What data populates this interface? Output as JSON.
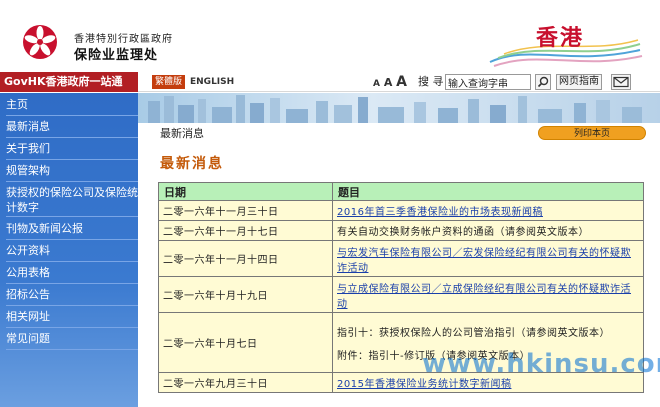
{
  "header": {
    "dept_line1": "香港特別行政區政府",
    "dept_line2": "保险业监理处",
    "brand": "香港"
  },
  "govbar": {
    "govhk": "GovHK香港政府一站通",
    "traditional": "繁體版",
    "english": "ENGLISH",
    "font_small": "A",
    "font_medium": "A",
    "font_large": "A",
    "search_label": "搜 寻",
    "search_value": "输入查询字串",
    "sitemap": "网页指南"
  },
  "sidebar": {
    "items": [
      {
        "label": "主页"
      },
      {
        "label": "最新消息"
      },
      {
        "label": "关于我们"
      },
      {
        "label": "规管架构"
      },
      {
        "label": "获授权的保险公司及保险统计数字"
      },
      {
        "label": "刊物及新闻公报"
      },
      {
        "label": "公开资料"
      },
      {
        "label": "公用表格"
      },
      {
        "label": "招标公告"
      },
      {
        "label": "相关网址"
      },
      {
        "label": "常见问题"
      }
    ]
  },
  "content": {
    "breadcrumb": "最新消息",
    "print_label": "列印本页",
    "title": "最新消息",
    "col_date": "日期",
    "col_subject": "题目",
    "rows": [
      {
        "date": "二零一六年十一月三十日",
        "subject": "2016年首三季香港保险业的市场表现新闻稿",
        "link": true
      },
      {
        "date": "二零一六年十一月十七日",
        "subject": "有关自动交换财务帐户资料的通函（请参阅英文版本）",
        "link": false
      },
      {
        "date": "二零一六年十一月十四日",
        "subject": "与宏发汽车保险有限公司／宏发保险经纪有限公司有关的怀疑欺诈活动",
        "link": true
      },
      {
        "date": "二零一六年十月十九日",
        "subject": "与立成保险有限公司／立成保险经纪有限公司有关的怀疑欺诈活动",
        "link": true
      },
      {
        "date": "二零一六年十月七日",
        "subject": "指引十：获授权保险人的公司管治指引（请参阅英文版本）",
        "subject_extra": "附件：指引十-修订版（请参阅英文版本）",
        "link": false
      },
      {
        "date": "二零一六年九月三十日",
        "subject": "2015年香港保险业务统计数字新闻稿",
        "link": true
      }
    ]
  },
  "watermark": "www.hkinsu.com",
  "colors": {
    "govhk_red": "#b21f24",
    "sidebar_blue": "#2f6cc6",
    "table_header": "#b8f0b8",
    "table_cell": "#fffbd4",
    "title_orange": "#c45a0a",
    "print_button": "#f0a020"
  }
}
